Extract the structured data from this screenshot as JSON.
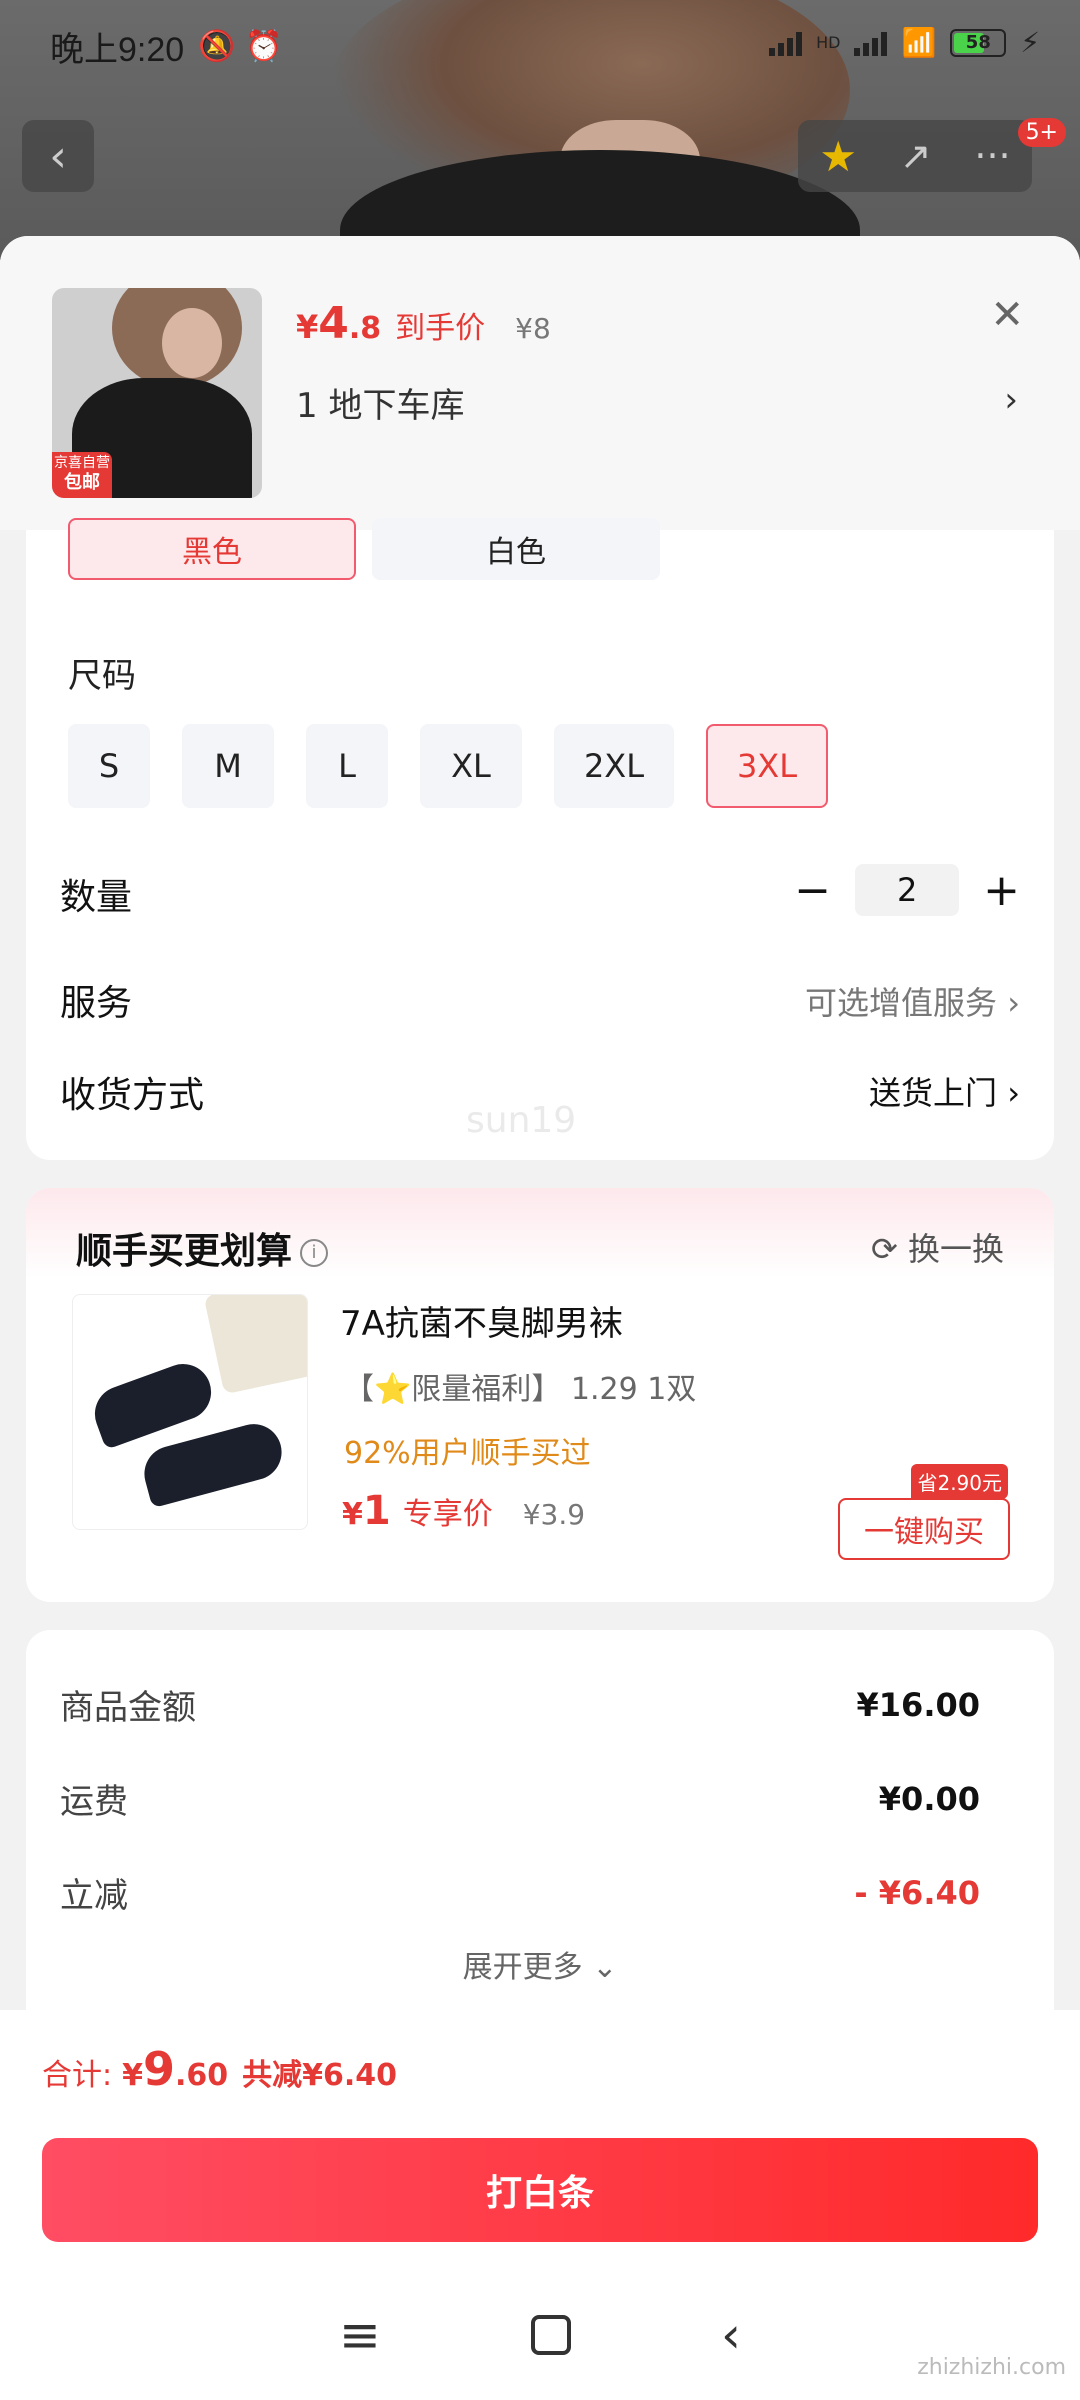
{
  "status": {
    "time": "晚上9:20",
    "icons": "🔕 ⏰",
    "network": "HD",
    "battery": "58"
  },
  "topnav": {
    "back": "‹",
    "share": "↗",
    "more": "···",
    "badge": "5+"
  },
  "product": {
    "price_symbol": "¥",
    "price_int": "4",
    "price_dec": ".8",
    "price_label": "到手价",
    "original_price": "¥8",
    "address": "1  地下车库",
    "thumb_tag_top": "京喜自营",
    "thumb_tag_bottom": "包邮"
  },
  "colors": {
    "options": [
      "黑色",
      "白色"
    ],
    "selected": "黑色"
  },
  "sizes": {
    "title": "尺码",
    "options": [
      "S",
      "M",
      "L",
      "XL",
      "2XL",
      "3XL"
    ],
    "selected": "3XL"
  },
  "quantity": {
    "label": "数量",
    "value": "2",
    "minus": "−",
    "plus": "+"
  },
  "service": {
    "label": "服务",
    "value": "可选增值服务"
  },
  "delivery": {
    "label": "收货方式",
    "value": "送货上门"
  },
  "watermark": "sun19",
  "suggest": {
    "title": "顺手买更划算",
    "swap": "换一换",
    "name": "7A抗菌不臭脚男袜",
    "sub_prefix": "【",
    "sub_star": "⭐",
    "sub_text": "限量福利】 1.29 1双",
    "pct": "92%用户顺手买过",
    "price_symbol": "¥",
    "price": "1",
    "price_label": "专享价",
    "orig": "¥3.9",
    "save_tag": "省2.90元",
    "buy_label": "一键购买"
  },
  "summary": {
    "rows": [
      {
        "label": "商品金额",
        "value": "¥16.00"
      },
      {
        "label": "运费",
        "value": "¥0.00"
      },
      {
        "label": "立减",
        "value": "- ¥6.40"
      }
    ],
    "expand": "展开更多 ⌄"
  },
  "footer": {
    "total_label": "合计:",
    "total_symbol": "¥",
    "total_int": "9",
    "total_dec": ".60",
    "total_saved": "共减¥6.40",
    "cta": "打白条"
  },
  "sysnav": {
    "menu": "≡",
    "back": "‹"
  },
  "corner_mark": "zhizhizhi.com",
  "accent": "#e53935"
}
